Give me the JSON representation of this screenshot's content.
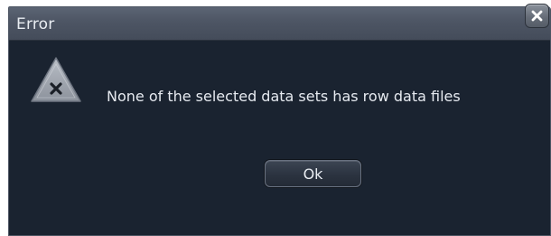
{
  "window": {
    "title": "Error",
    "close_label": "×"
  },
  "dialog": {
    "icon": "warning-triangle-x-icon",
    "message": "None of the selected data sets has row data files",
    "ok_label": "Ok"
  },
  "colors": {
    "dialog_background": "#1a2330",
    "titlebar": "#4d5564",
    "text": "#e6eaf0"
  }
}
